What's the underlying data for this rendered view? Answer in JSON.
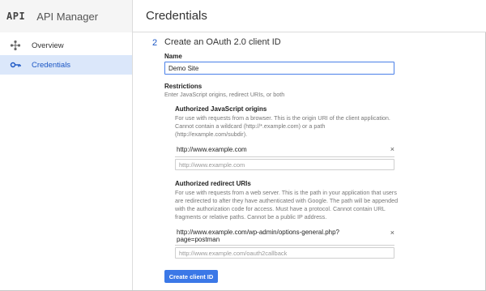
{
  "header": {
    "logo": "API",
    "app_title": "API Manager",
    "page_title": "Credentials"
  },
  "sidebar": {
    "items": [
      {
        "label": "Overview",
        "icon": "overview-diamond-icon",
        "active": false
      },
      {
        "label": "Credentials",
        "icon": "key-icon",
        "active": true
      }
    ]
  },
  "form": {
    "step_number": "2",
    "step_title": "Create an OAuth 2.0 client ID",
    "name_label": "Name",
    "name_value": "Demo Site",
    "restrictions_label": "Restrictions",
    "restrictions_help": "Enter JavaScript origins, redirect URIs, or both",
    "origins": {
      "label": "Authorized JavaScript origins",
      "help": [
        "For use with requests from a browser. This is the origin URI of the client application.",
        "Cannot contain a wildcard (http://*.example.com) or a path",
        "(http://example.com/subdir)."
      ],
      "entries": [
        "http://www.example.com"
      ],
      "placeholder": "http://www.example.com"
    },
    "redirects": {
      "label": "Authorized redirect URIs",
      "help": [
        "For use with requests from a web server. This is the path in your application that users",
        "are redirected to after they have authenticated with Google. The path will be appended",
        "with the authorization code for access. Must have a protocol. Cannot contain URL",
        "fragments or relative paths. Cannot be a public IP address."
      ],
      "entries": [
        [
          "http://www.example.com/wp-admin/options-general.php?",
          "page=postman"
        ]
      ],
      "placeholder": "http://www.example.com/oauth2callback"
    },
    "remove_symbol": "×",
    "submit_label": "Create client ID"
  },
  "colors": {
    "accent": "#3b78e7",
    "active_nav_bg": "#dbe7fa",
    "active_nav_text": "#1a56c4"
  }
}
